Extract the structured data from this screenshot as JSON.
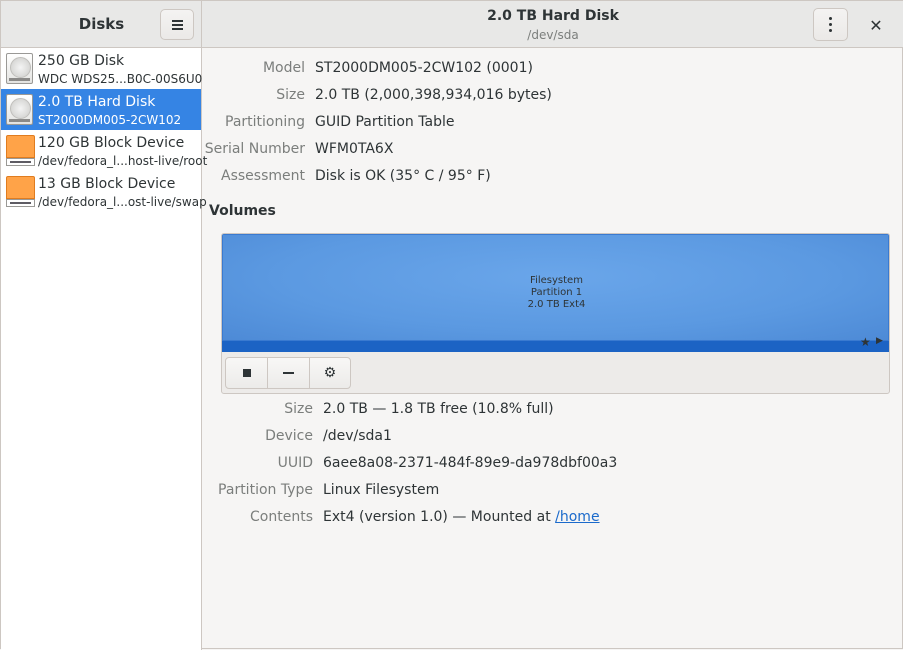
{
  "sidebar": {
    "title": "Disks",
    "drives": [
      {
        "name": "250 GB Disk",
        "sub": "WDC WDS25...B0C-00S6U0",
        "icon": "hard-disk-icon",
        "selected": false
      },
      {
        "name": "2.0 TB Hard Disk",
        "sub": "ST2000DM005-2CW102",
        "icon": "hard-disk-icon",
        "selected": true
      },
      {
        "name": "120 GB Block Device",
        "sub": "/dev/fedora_l...host-live/root",
        "icon": "block-device-icon",
        "selected": false
      },
      {
        "name": "13 GB Block Device",
        "sub": "/dev/fedora_l...ost-live/swap",
        "icon": "block-device-icon",
        "selected": false
      }
    ]
  },
  "header": {
    "title": "2.0 TB Hard Disk",
    "subtitle": "/dev/sda",
    "close": "✕"
  },
  "disk": {
    "labels": {
      "model": "Model",
      "size": "Size",
      "partitioning": "Partitioning",
      "serial": "Serial Number",
      "assessment": "Assessment"
    },
    "values": {
      "model": "ST2000DM005-2CW102 (0001)",
      "size": "2.0 TB (2,000,398,934,016 bytes)",
      "partitioning": "GUID Partition Table",
      "serial": "WFM0TA6X",
      "assessment": "Disk is OK (35° C / 95° F)"
    }
  },
  "volumes": {
    "heading": "Volumes",
    "partition": {
      "line1": "Filesystem",
      "line2": "Partition 1",
      "line3": "2.0 TB Ext4"
    },
    "fill_fraction": 1.0,
    "tools": [
      "stop-icon",
      "minus-icon",
      "gears-icon"
    ]
  },
  "partition_details": {
    "labels": {
      "size": "Size",
      "device": "Device",
      "uuid": "UUID",
      "ptype": "Partition Type",
      "contents": "Contents"
    },
    "values": {
      "size": "2.0 TB — 1.8 TB free (10.8% full)",
      "device": "/dev/sda1",
      "uuid": "6aee8a08-2371-484f-89e9-da978dbf00a3",
      "ptype": "Linux Filesystem",
      "contents_prefix": "Ext4 (version 1.0) — Mounted at ",
      "contents_link": "/home"
    }
  },
  "colors": {
    "accent": "#3584e4",
    "partition": "#5b99e1",
    "usage": "#1c63c4",
    "block_device": "#ffa348"
  }
}
